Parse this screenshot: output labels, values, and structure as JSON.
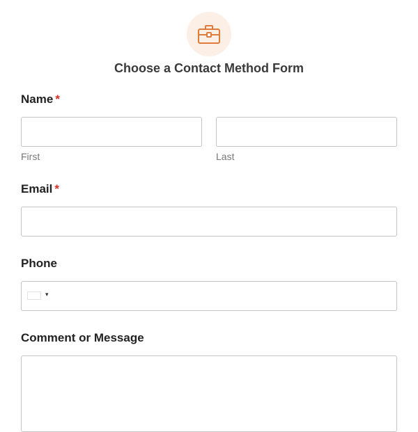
{
  "form": {
    "title": "Choose a Contact Method Form",
    "icon": "briefcase-icon",
    "accent_color": "#e07b39",
    "icon_bg_color": "#fcefe6",
    "required_color": "#d93025"
  },
  "fields": {
    "name": {
      "label": "Name",
      "required_marker": "*",
      "first_value": "",
      "first_sublabel": "First",
      "last_value": "",
      "last_sublabel": "Last"
    },
    "email": {
      "label": "Email",
      "required_marker": "*",
      "value": ""
    },
    "phone": {
      "label": "Phone",
      "country_caret": "▾",
      "value": ""
    },
    "comment": {
      "label": "Comment or Message",
      "value": ""
    }
  }
}
